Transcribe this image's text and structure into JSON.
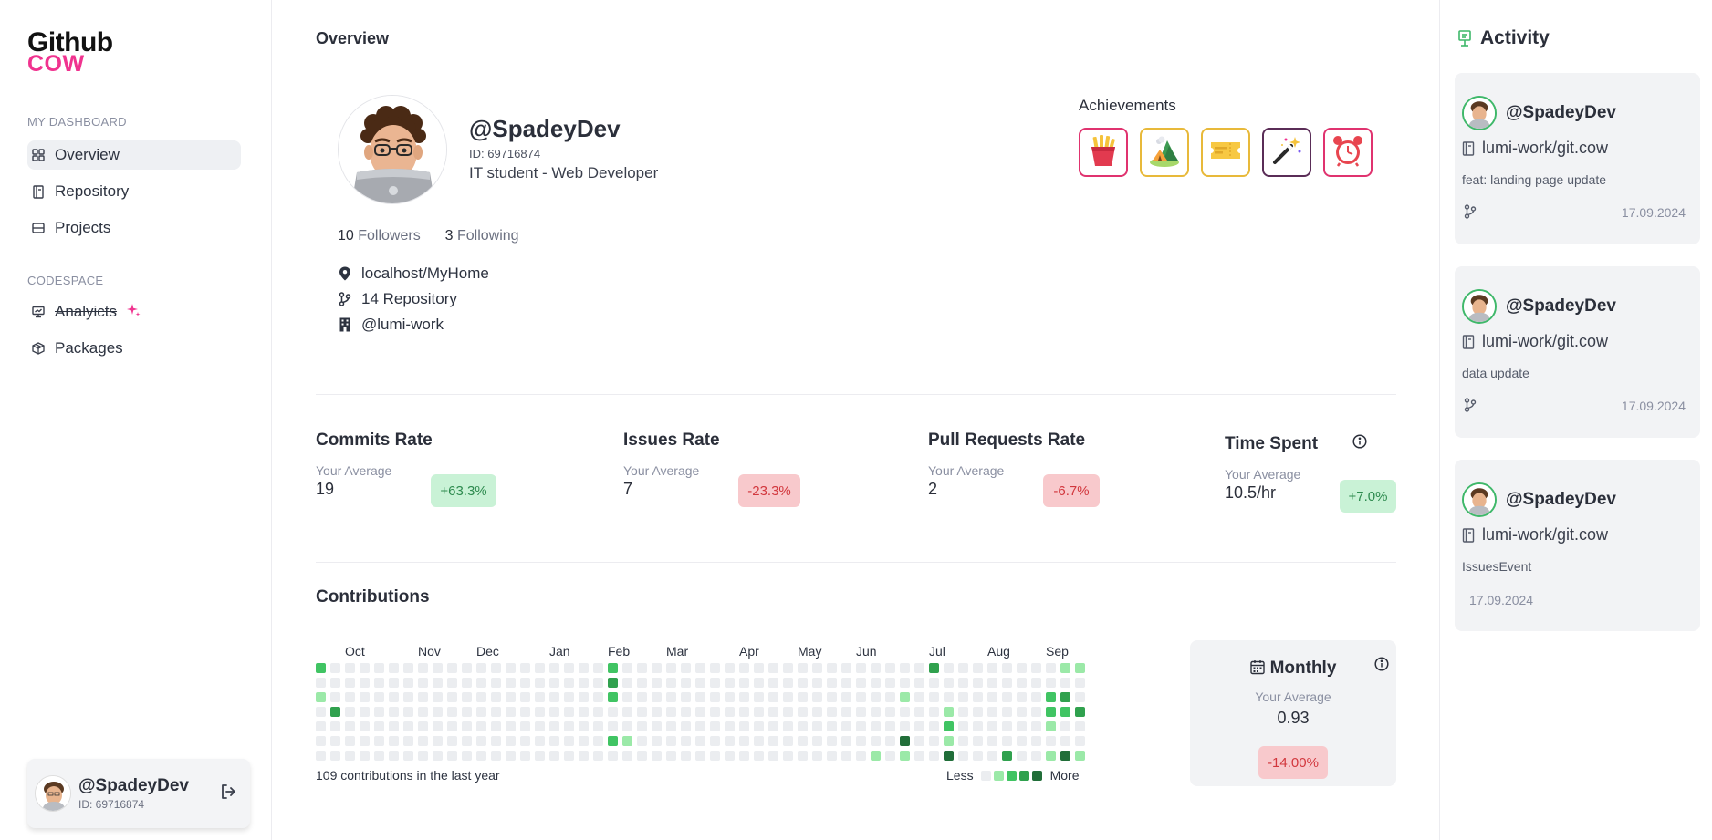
{
  "app": {
    "logo_top": "Github",
    "logo_bottom": "COW",
    "brand_color": "#f0338f"
  },
  "sidebar": {
    "section_dashboard": "MY DASHBOARD",
    "dashboard_items": [
      {
        "label": "Overview",
        "icon": "grid-icon",
        "active": true
      },
      {
        "label": "Repository",
        "icon": "book-icon",
        "active": false
      },
      {
        "label": "Projects",
        "icon": "table-icon",
        "active": false
      }
    ],
    "section_codespace": "CODESPACE",
    "codespace_items": [
      {
        "label": "Analyicts",
        "icon": "presentation-icon",
        "strikethrough": true,
        "badge_icon": "sparkle-icon"
      },
      {
        "label": "Packages",
        "icon": "package-icon"
      }
    ],
    "user": {
      "name": "@SpadeyDev",
      "id": "ID: 69716874",
      "action_icon": "logout-icon"
    }
  },
  "main": {
    "title": "Overview",
    "profile": {
      "handle": "@SpadeyDev",
      "id": "ID: 69716874",
      "bio": "IT student - Web Developer",
      "followers_count": "10",
      "followers_label": "Followers",
      "following_count": "3",
      "following_label": "Following",
      "location": "localhost/MyHome",
      "repositories": "14 Repository",
      "organization": "@lumi-work"
    },
    "achievements": {
      "label": "Achievements",
      "items": [
        {
          "icon": "fries-icon",
          "border": "#e0336f"
        },
        {
          "icon": "camp-icon",
          "border": "#e8b93a"
        },
        {
          "icon": "ticket-icon",
          "border": "#e8b93a"
        },
        {
          "icon": "magic-wand-icon",
          "border": "#5a2d57"
        },
        {
          "icon": "alarm-clock-icon",
          "border": "#e0336f"
        }
      ]
    },
    "stats": [
      {
        "title": "Commits Rate",
        "label": "Your Average",
        "value": "19",
        "change": "+63.3%",
        "trend": "positive"
      },
      {
        "title": "Issues Rate",
        "label": "Your Average",
        "value": "7",
        "change": "-23.3%",
        "trend": "negative"
      },
      {
        "title": "Pull Requests Rate",
        "label": "Your Average",
        "value": "2",
        "change": "-6.7%",
        "trend": "negative"
      },
      {
        "title": "Time Spent",
        "label": "Your Average",
        "value": "10.5/hr",
        "change": "+7.0%",
        "trend": "positive"
      }
    ],
    "contributions": {
      "title": "Contributions",
      "months": [
        "Oct",
        "Nov",
        "Dec",
        "Jan",
        "Feb",
        "Mar",
        "Apr",
        "May",
        "Jun",
        "Jul",
        "Aug",
        "Sep"
      ],
      "month_start_weeks": [
        2,
        7,
        11,
        16,
        20,
        24,
        29,
        33,
        37,
        42,
        46,
        50
      ],
      "weeks": 54,
      "levels_colors": [
        "#ebedf0",
        "#9be9a8",
        "#40c463",
        "#30a14e",
        "#216e39"
      ],
      "cells": [
        [
          0,
          0,
          2
        ],
        [
          0,
          2,
          1
        ],
        [
          1,
          3,
          3
        ],
        [
          20,
          0,
          2
        ],
        [
          20,
          1,
          3
        ],
        [
          20,
          2,
          2
        ],
        [
          20,
          5,
          2
        ],
        [
          21,
          5,
          1
        ],
        [
          38,
          6,
          1
        ],
        [
          40,
          2,
          1
        ],
        [
          40,
          5,
          4
        ],
        [
          40,
          6,
          1
        ],
        [
          42,
          0,
          3
        ],
        [
          43,
          3,
          1
        ],
        [
          43,
          4,
          2
        ],
        [
          43,
          5,
          1
        ],
        [
          43,
          6,
          4
        ],
        [
          47,
          6,
          3
        ],
        [
          50,
          2,
          2
        ],
        [
          50,
          3,
          2
        ],
        [
          50,
          4,
          1
        ],
        [
          50,
          6,
          1
        ],
        [
          51,
          0,
          1
        ],
        [
          51,
          2,
          3
        ],
        [
          51,
          3,
          2
        ],
        [
          51,
          6,
          4
        ],
        [
          51,
          7,
          1
        ],
        [
          52,
          0,
          1
        ],
        [
          52,
          3,
          3
        ],
        [
          52,
          6,
          1
        ],
        [
          52,
          7,
          1
        ],
        [
          53,
          1,
          4
        ],
        [
          53,
          2,
          4
        ]
      ],
      "summary": "109 contributions in the last year",
      "legend_less": "Less",
      "legend_more": "More"
    },
    "monthly": {
      "title": "Monthly",
      "label": "Your Average",
      "value": "0.93",
      "change": "-14.00%",
      "trend": "negative"
    }
  },
  "activity": {
    "title": "Activity",
    "items": [
      {
        "user": "@SpadeyDev",
        "repo": "lumi-work/git.cow",
        "message": "feat: landing page update",
        "date": "17.09.2024",
        "has_branch_icon": true
      },
      {
        "user": "@SpadeyDev",
        "repo": "lumi-work/git.cow",
        "message": "data update",
        "date": "17.09.2024",
        "has_branch_icon": true
      },
      {
        "user": "@SpadeyDev",
        "repo": "lumi-work/git.cow",
        "message": "IssuesEvent",
        "date": "17.09.2024",
        "has_branch_icon": false
      }
    ]
  }
}
